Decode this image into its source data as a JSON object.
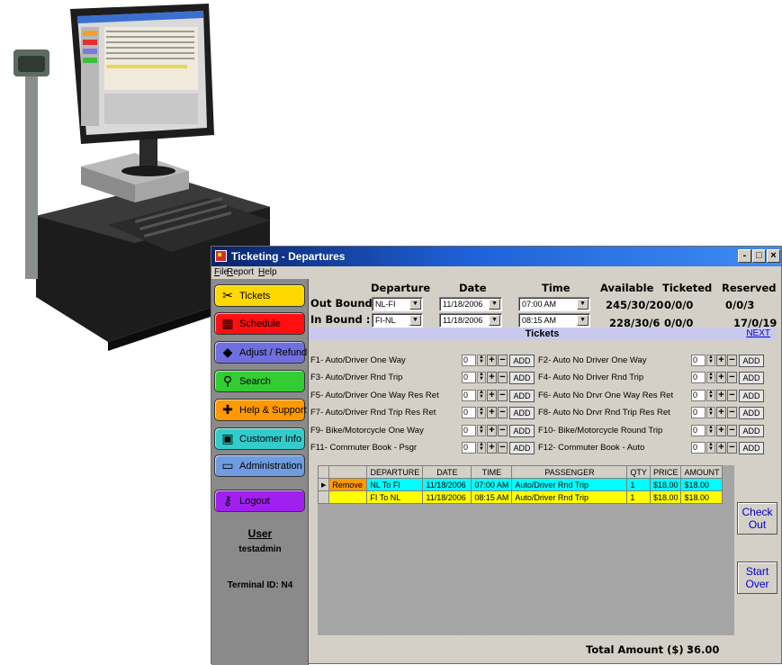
{
  "window": {
    "title": "Ticketing - Departures",
    "controls": [
      "-",
      "□",
      "×"
    ]
  },
  "menu": [
    {
      "key": "F",
      "rest": "ile"
    },
    {
      "key": "R",
      "rest": "eport"
    },
    {
      "key": "H",
      "rest": "elp"
    }
  ],
  "sidebar": {
    "items": [
      {
        "label": "Tickets",
        "icon": "ticket-icon",
        "color": "#ffd800"
      },
      {
        "label": "Schedule",
        "icon": "calendar-icon",
        "color": "#ff1010"
      },
      {
        "label": "Adjust / Refund",
        "icon": "adjust-icon",
        "color": "#6f6fe0"
      },
      {
        "label": "Search",
        "icon": "search-icon",
        "color": "#33cc33"
      },
      {
        "label": "Help & Support",
        "icon": "help-icon",
        "color": "#ff9900"
      },
      {
        "label": "Customer Info",
        "icon": "customer-icon",
        "color": "#33cccc"
      },
      {
        "label": "Administration",
        "icon": "folder-icon",
        "color": "#6f9ce0"
      },
      {
        "label": "Logout",
        "icon": "key-icon",
        "color": "#a020f0"
      }
    ],
    "user_heading": "User",
    "user_name": "testadmin",
    "terminal": "Terminal ID: N4"
  },
  "header": {
    "departure": "Departure",
    "date": "Date",
    "time": "Time",
    "available": "Available",
    "ticketed": "Ticketed",
    "reserved": "Reserved"
  },
  "outbound": {
    "label": "Out Bound :",
    "departure": "NL-FI",
    "date": "11/18/2006",
    "time": "07:00 AM",
    "available": "245/30/20",
    "ticketed": "0/0/0",
    "reserved": "0/0/3"
  },
  "inbound": {
    "label": "In Bound :",
    "departure": "FI-NL",
    "date": "11/18/2006",
    "time": "08:15 AM",
    "available": "228/30/6",
    "ticketed": "0/0/0",
    "reserved": "17/0/19"
  },
  "tickets_title": "Tickets",
  "next_link": "NEXT",
  "add_label": "ADD",
  "ticket_types": [
    {
      "left": "F1- Auto/Driver One Way",
      "left_qty": "0",
      "right": "F2- Auto No Driver One Way",
      "right_qty": "0"
    },
    {
      "left": "F3- Auto/Driver Rnd Trip",
      "left_qty": "0",
      "right": "F4- Auto No Driver Rnd Trip",
      "right_qty": "0"
    },
    {
      "left": "F5- Auto/Driver One Way Res Ret",
      "left_qty": "0",
      "right": "F6- Auto No Drvr One Way Res Ret",
      "right_qty": "0"
    },
    {
      "left": "F7- Auto/Driver Rnd Trip Res Ret",
      "left_qty": "0",
      "right": "F8- Auto No Drvr Rnd Trip Res Ret",
      "right_qty": "0"
    },
    {
      "left": "F9- Bike/Motorcycle One Way",
      "left_qty": "0",
      "right": "F10- Bike/Motorcycle Round Trip",
      "right_qty": "0"
    },
    {
      "left": "F11- Commuter Book - Psgr",
      "left_qty": "0",
      "right": "F12- Commuter Book - Auto",
      "right_qty": "0"
    }
  ],
  "cart": {
    "columns": [
      "DEPARTURE",
      "DATE",
      "TIME",
      "PASSENGER",
      "QTY",
      "PRICE",
      "AMOUNT"
    ],
    "remove_label": "Remove",
    "rows": [
      {
        "departure": "NL To FI",
        "date": "11/18/2006",
        "time": "07:00 AM",
        "passenger": "Auto/Driver Rnd Trip",
        "qty": "1",
        "price": "$18.00",
        "amount": "$18.00"
      },
      {
        "departure": "FI To NL",
        "date": "11/18/2006",
        "time": "08:15 AM",
        "passenger": "Auto/Driver Rnd Trip",
        "qty": "1",
        "price": "$18.00",
        "amount": "$18.00"
      }
    ]
  },
  "checkout": {
    "line1": "Check",
    "line2": "Out"
  },
  "startover": {
    "line1": "Start",
    "line2": "Over"
  },
  "total_label": "Total Amount ($) :",
  "total_value": "36.00",
  "colors": {
    "titlebar": "#0a246a",
    "row_selected": "#00ffff",
    "row_normal": "#ffff00",
    "remove": "#ff9900",
    "tickets_band": "#c9c9f0",
    "link": "#0000cc"
  }
}
